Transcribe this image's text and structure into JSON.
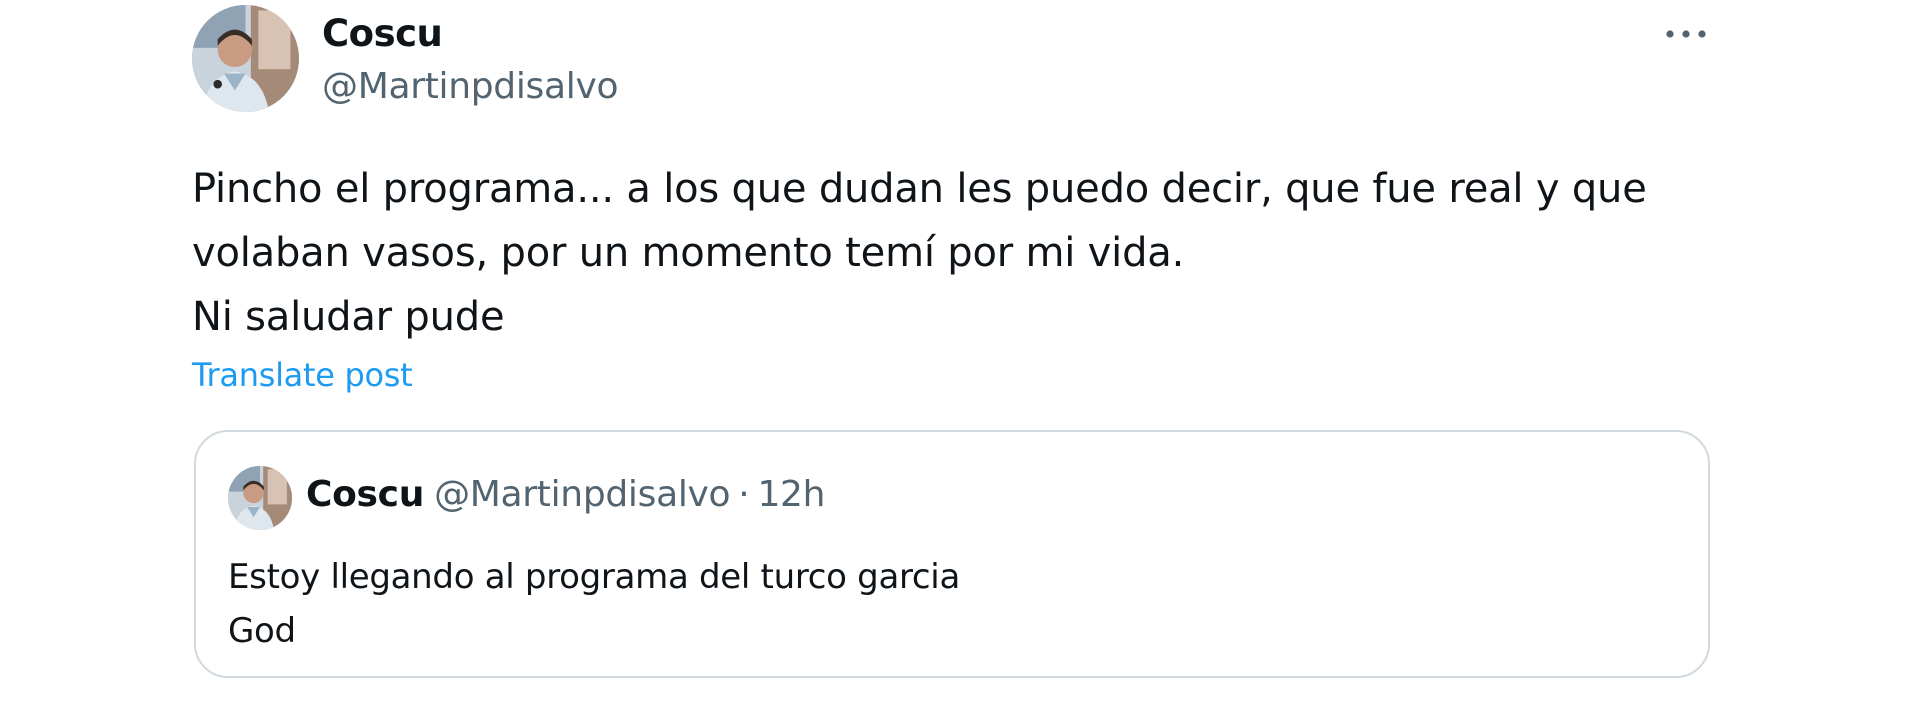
{
  "tweet": {
    "author": {
      "display_name": "Coscu",
      "handle": "@Martinpdisalvo",
      "avatar_icon": "user-avatar-photo"
    },
    "more_icon": "more-horizontal-icon",
    "text_lines": [
      "Pincho el programa... a los que dudan les puedo decir, que fue real y que",
      "volaban vasos, por un momento temí por mi vida.",
      "Ni saludar pude"
    ],
    "translate_label": "Translate post"
  },
  "quoted_tweet": {
    "display_name": "Coscu",
    "handle": "@Martinpdisalvo",
    "separator": "·",
    "time": "12h",
    "text_lines": [
      "Estoy llegando al programa del turco garcia",
      "God"
    ]
  },
  "colors": {
    "text_primary": "#0f1419",
    "text_secondary": "#536471",
    "link": "#1d9bf0",
    "border": "#cfd9de"
  }
}
